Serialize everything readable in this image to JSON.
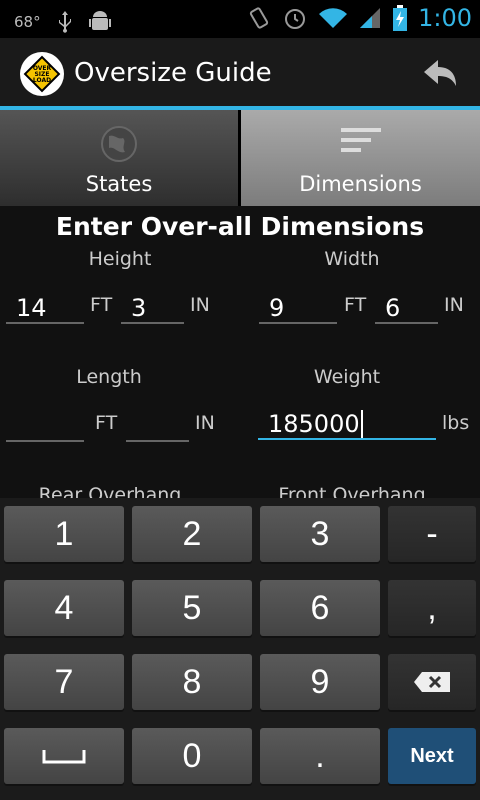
{
  "status_bar": {
    "battery_temp": "68°",
    "time": "1:00"
  },
  "app": {
    "title": "Oversize Guide",
    "logo_text": "OVER SIZE LOAD"
  },
  "tabs": [
    {
      "label": "States"
    },
    {
      "label": "Dimensions"
    }
  ],
  "form": {
    "heading": "Enter Over-all Dimensions",
    "height": {
      "label": "Height",
      "ft": "14",
      "in": "3"
    },
    "width": {
      "label": "Width",
      "ft": "9",
      "in": "6"
    },
    "length": {
      "label": "Length",
      "ft": "",
      "in": ""
    },
    "weight": {
      "label": "Weight",
      "value": "185000",
      "unit": "lbs"
    },
    "rear_overhang": {
      "label": "Rear Overhang"
    },
    "front_overhang": {
      "label": "Front Overhang"
    },
    "unit_ft": "FT",
    "unit_in": "IN"
  },
  "keyboard": {
    "rows": [
      [
        "1",
        "2",
        "3",
        "-"
      ],
      [
        "4",
        "5",
        "6",
        ","
      ],
      [
        "7",
        "8",
        "9",
        "backspace"
      ],
      [
        "space",
        "0",
        ".",
        "Next"
      ]
    ]
  },
  "colors": {
    "accent": "#33b5e5",
    "next_key": "#1f4f77"
  }
}
